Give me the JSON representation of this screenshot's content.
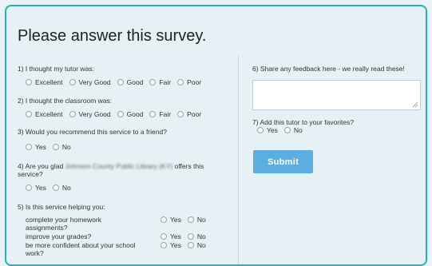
{
  "survey": {
    "title": "Please answer this survey.",
    "q1": {
      "label": "1) I thought my tutor was:",
      "options": [
        "Excellent",
        "Very Good",
        "Good",
        "Fair",
        "Poor"
      ]
    },
    "q2": {
      "label": "2) I thought the classroom was:",
      "options": [
        "Excellent",
        "Very Good",
        "Good",
        "Fair",
        "Poor"
      ]
    },
    "q3": {
      "label": "3) Would you recommend this service to a friend?",
      "options": [
        "Yes",
        "No"
      ]
    },
    "q4": {
      "label_before": "4) Are you glad",
      "label_blurred": "Johnson County Public Library (KY)",
      "label_after": "offers this",
      "label_line2": "service?",
      "options": [
        "Yes",
        "No"
      ]
    },
    "q5": {
      "label": "5) Is this service helping you:",
      "items": [
        {
          "line1": "complete your homework",
          "line2": "assignments?",
          "yes": "Yes",
          "no": "No"
        },
        {
          "line1": "improve your grades?",
          "line2": "",
          "yes": "Yes",
          "no": "No"
        },
        {
          "line1": "be more confident about your school",
          "line2": "work?",
          "yes": "Yes",
          "no": "No"
        }
      ]
    },
    "q6": {
      "label": "6) Share any feedback here - we really read these!"
    },
    "q7": {
      "label": "7) Add this tutor to your favorites?",
      "options": [
        "Yes",
        "No"
      ]
    },
    "submit_label": "Submit"
  },
  "colors": {
    "accent_border": "#1fb5b0",
    "submit_bg": "#5aaee0"
  }
}
